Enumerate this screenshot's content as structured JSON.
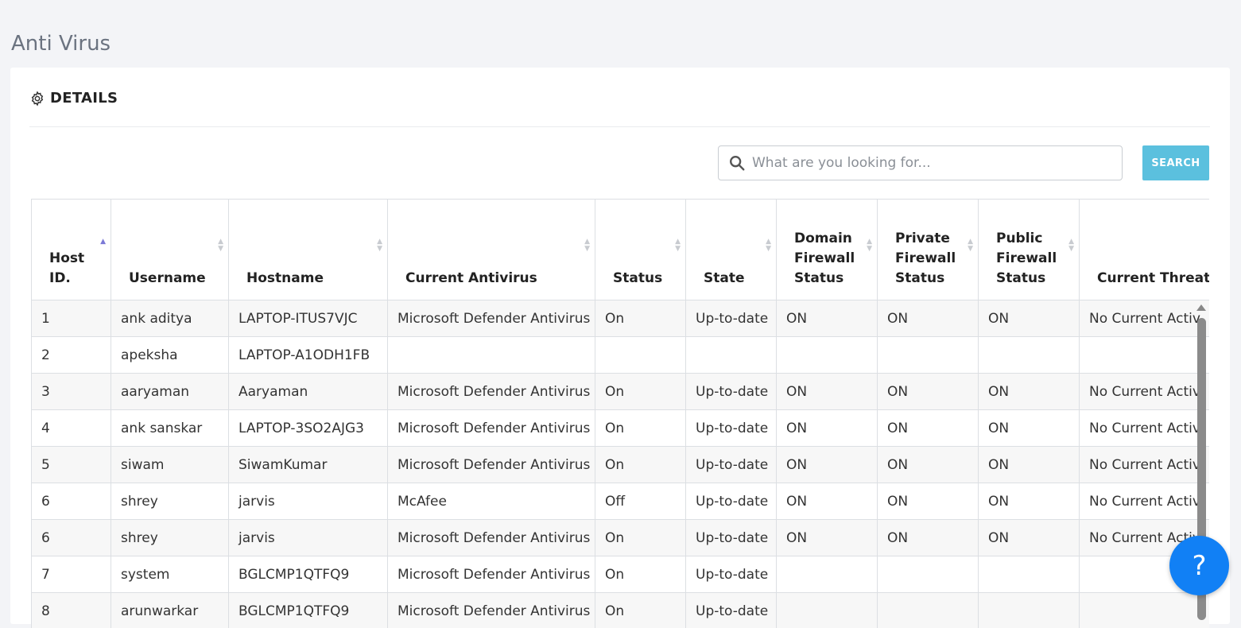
{
  "page": {
    "title": "Anti Virus"
  },
  "details": {
    "title": "DETAILS"
  },
  "search": {
    "placeholder": "What are you looking for...",
    "button_label": "SEARCH"
  },
  "table": {
    "columns": [
      "Host ID.",
      "Username",
      "Hostname",
      "Current Antivirus",
      "Status",
      "State",
      "Domain Firewall Status",
      "Private Firewall Status",
      "Public Firewall Status",
      "Current Threat N"
    ],
    "rows": [
      [
        "1",
        "ank aditya",
        "LAPTOP-ITUS7VJC",
        "Microsoft Defender Antivirus",
        "On",
        "Up-to-date",
        "ON",
        "ON",
        "ON",
        "No Current Activ"
      ],
      [
        "2",
        "apeksha",
        "LAPTOP-A1ODH1FB",
        "",
        "",
        "",
        "",
        "",
        "",
        ""
      ],
      [
        "3",
        "aaryaman",
        "Aaryaman",
        "Microsoft Defender Antivirus",
        "On",
        "Up-to-date",
        "ON",
        "ON",
        "ON",
        "No Current Activ"
      ],
      [
        "4",
        "ank sanskar",
        "LAPTOP-3SO2AJG3",
        "Microsoft Defender Antivirus",
        "On",
        "Up-to-date",
        "ON",
        "ON",
        "ON",
        "No Current Activ"
      ],
      [
        "5",
        "siwam",
        "SiwamKumar",
        "Microsoft Defender Antivirus",
        "On",
        "Up-to-date",
        "ON",
        "ON",
        "ON",
        "No Current Activ"
      ],
      [
        "6",
        "shrey",
        "jarvis",
        "McAfee",
        "Off",
        "Up-to-date",
        "ON",
        "ON",
        "ON",
        "No Current Activ"
      ],
      [
        "6",
        "shrey",
        "jarvis",
        "Microsoft Defender Antivirus",
        "On",
        "Up-to-date",
        "ON",
        "ON",
        "ON",
        "No Current Activ"
      ],
      [
        "7",
        "system",
        "BGLCMP1QTFQ9",
        "Microsoft Defender Antivirus",
        "On",
        "Up-to-date",
        "",
        "",
        "",
        ""
      ],
      [
        "8",
        "arunwarkar",
        "BGLCMP1QTFQ9",
        "Microsoft Defender Antivirus",
        "On",
        "Up-to-date",
        "",
        "",
        "",
        ""
      ]
    ]
  },
  "help": {
    "label": "?"
  },
  "colors": {
    "search_button": "#5bc0de",
    "help_button": "#1180f5",
    "sort_active": "#7b79d6"
  },
  "icons": {
    "header": "gear-icon",
    "search": "search-icon",
    "sort": "sort-icon",
    "help": "help-icon"
  }
}
